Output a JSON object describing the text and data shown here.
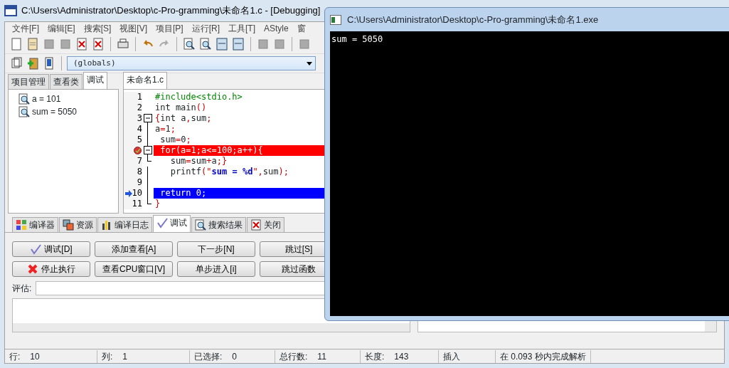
{
  "window": {
    "title": "C:\\Users\\Administrator\\Desktop\\c-Pro-gramming\\未命名1.c - [Debugging]"
  },
  "menu": [
    "文件[F]",
    "编辑[E]",
    "搜索[S]",
    "视图[V]",
    "项目[P]",
    "运行[R]",
    "工具[T]",
    "AStyle",
    "窗"
  ],
  "scope_dropdown": {
    "value": "(globals)"
  },
  "left_tabs": [
    {
      "label": "项目管理",
      "selected": false
    },
    {
      "label": "查看类",
      "selected": false
    },
    {
      "label": "调试",
      "selected": true
    }
  ],
  "watch_items": [
    "a = 101",
    "sum = 5050"
  ],
  "editor_tab": {
    "label": "未命名1.c",
    "selected": true
  },
  "code_lines": [
    {
      "number": "1",
      "text": "#include<stdio.h>"
    },
    {
      "number": "2",
      "text": "int main()"
    },
    {
      "number": "3",
      "text": "{int a,sum;",
      "fold_start": true
    },
    {
      "number": "4",
      "text": "a=1;"
    },
    {
      "number": "5",
      "text": " sum=0;"
    },
    {
      "text": " for(a=1;a<=100;a++){",
      "fold_start": true,
      "kind": "breakpoint"
    },
    {
      "number": "7",
      "text": "   sum=sum+a;}",
      "fold_end": true
    },
    {
      "number": "8",
      "text": "   printf(\"sum = %d\",sum);"
    },
    {
      "number": "9"
    },
    {
      "number": "10",
      "text": " return 0;",
      "kind": "current"
    },
    {
      "number": "11",
      "text": "}",
      "fold_end": true
    }
  ],
  "bottom_tabs": [
    {
      "label": "编译器",
      "selected": false
    },
    {
      "label": "资源",
      "selected": false
    },
    {
      "label": "编译日志",
      "selected": false
    },
    {
      "label": "调试",
      "selected": true
    },
    {
      "label": "搜索结果",
      "selected": false
    },
    {
      "label": "关闭",
      "selected": false
    }
  ],
  "debug_buttons": [
    "调试[D]",
    "添加查看[A]",
    "下一步[N]",
    "跳过[S]",
    "停止执行",
    "查看CPU窗口[V]",
    "单步进入[i]",
    "跳过函数"
  ],
  "evaluate": {
    "label": "评估:"
  },
  "status_bar": [
    {
      "label": "行:",
      "value": "10"
    },
    {
      "label": "列:",
      "value": "1"
    },
    {
      "label": "已选择:",
      "value": "0"
    },
    {
      "label": "总行数:",
      "value": "11"
    },
    {
      "label": "长度:",
      "value": "143"
    },
    {
      "label": "插入"
    },
    {
      "label": "在 0.093 秒内完成解析"
    }
  ],
  "console": {
    "title": "C:\\Users\\Administrator\\Desktop\\c-Pro-gramming\\未命名1.exe",
    "output": "sum = 5050"
  }
}
